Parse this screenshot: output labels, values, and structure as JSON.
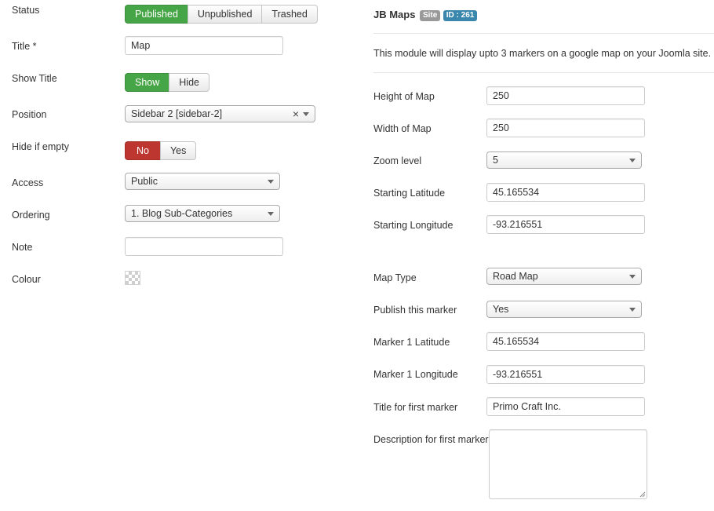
{
  "left": {
    "status": {
      "label": "Status",
      "options": [
        "Published",
        "Unpublished",
        "Trashed"
      ]
    },
    "title": {
      "label": "Title *",
      "value": "Map"
    },
    "show_title": {
      "label": "Show Title",
      "options": [
        "Show",
        "Hide"
      ]
    },
    "position": {
      "label": "Position",
      "value": "Sidebar 2 [sidebar-2]",
      "clear": "×"
    },
    "hide_if_empty": {
      "label": "Hide if empty",
      "options": [
        "No",
        "Yes"
      ]
    },
    "access": {
      "label": "Access",
      "value": "Public"
    },
    "ordering": {
      "label": "Ordering",
      "value": "1. Blog Sub-Categories"
    },
    "note": {
      "label": "Note",
      "value": ""
    },
    "colour": {
      "label": "Colour"
    }
  },
  "right": {
    "header": {
      "title": "JB Maps",
      "badge_site": "Site",
      "badge_id": "ID : 261",
      "description": "This module will display upto 3 markers on a google map on your Joomla site."
    },
    "fields": {
      "height_of_map": {
        "label": "Height of Map",
        "value": "250"
      },
      "width_of_map": {
        "label": "Width of Map",
        "value": "250"
      },
      "zoom_level": {
        "label": "Zoom level",
        "value": "5"
      },
      "starting_latitude": {
        "label": "Starting Latitude",
        "value": "45.165534"
      },
      "starting_longitude": {
        "label": "Starting Longitude",
        "value": "-93.216551"
      },
      "map_type": {
        "label": "Map Type",
        "value": "Road Map"
      },
      "publish_marker": {
        "label": "Publish this marker",
        "value": "Yes"
      },
      "marker1_latitude": {
        "label": "Marker 1 Latitude",
        "value": "45.165534"
      },
      "marker1_longitude": {
        "label": "Marker 1 Longitude",
        "value": "-93.216551"
      },
      "title_first_marker": {
        "label": "Title for first marker",
        "value": "Primo Craft Inc."
      },
      "description_first_marker": {
        "label": "Description for first marker",
        "value": ""
      }
    }
  },
  "colors": {
    "green_active": "#46a546",
    "red_active": "#bd362f",
    "badge_site": "#999999",
    "badge_id": "#3a87ad"
  }
}
